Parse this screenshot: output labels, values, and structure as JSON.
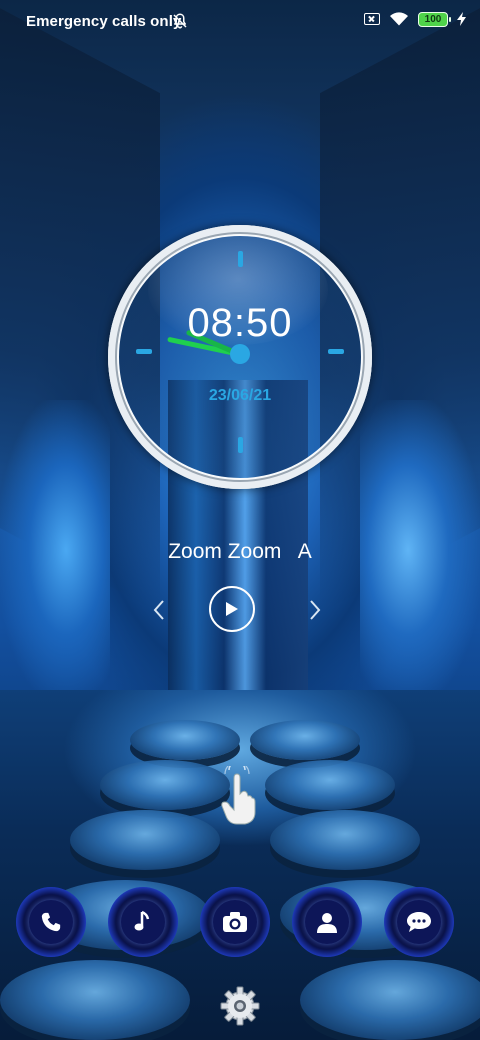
{
  "status_bar": {
    "carrier_text": "Emergency calls only",
    "battery_level": "100",
    "icons": [
      "notifications-off-icon",
      "no-sim-icon",
      "wifi-icon",
      "battery-icon",
      "charging-bolt-icon"
    ]
  },
  "clock_widget": {
    "time": "08:50",
    "date": "23/06/21",
    "accent_color": "#2aa7e3",
    "hand_color": "#1fd04e"
  },
  "music": {
    "title": "Zoom Zoom   A",
    "controls": [
      "previous-icon",
      "play-icon",
      "next-icon"
    ]
  },
  "dock": {
    "apps": [
      "phone-icon",
      "music-note-icon",
      "camera-icon",
      "contacts-icon",
      "messages-icon"
    ]
  },
  "bottom": {
    "icons": [
      "settings-gear-icon"
    ]
  }
}
